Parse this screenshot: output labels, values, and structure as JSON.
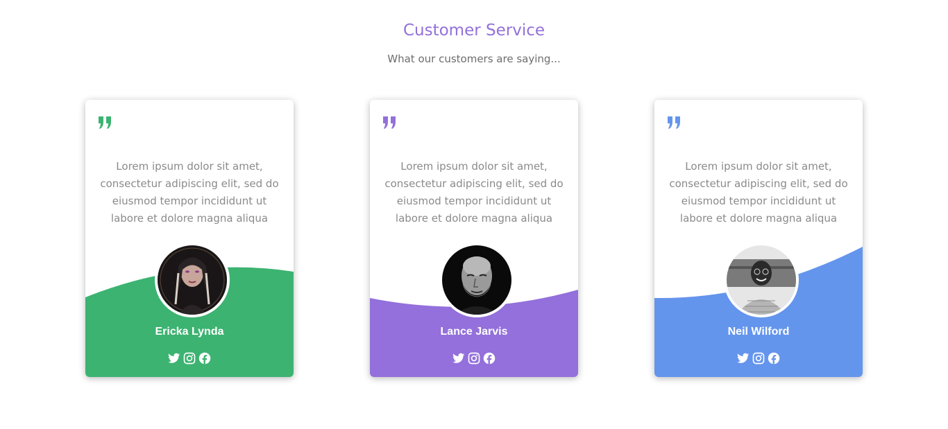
{
  "header": {
    "title": "Customer Service",
    "subtitle": "What our customers are saying..."
  },
  "cards": [
    {
      "quote_mark": "”",
      "text": "Lorem ipsum dolor sit amet, consectetur adipiscing elit, sed do eiusmod tempor incididunt ut labore et dolore magna aliqua",
      "name": "Ericka Lynda",
      "accent": "#3CB371",
      "avatar": "portrait-woman-dark-photo",
      "socials": [
        "twitter-icon",
        "instagram-icon",
        "facebook-icon"
      ]
    },
    {
      "quote_mark": "”",
      "text": "Lorem ipsum dolor sit amet, consectetur adipiscing elit, sed do eiusmod tempor incididunt ut labore et dolore magna aliqua",
      "name": "Lance Jarvis",
      "accent": "#9370DB",
      "avatar": "portrait-older-man-bw-photo",
      "socials": [
        "twitter-icon",
        "instagram-icon",
        "facebook-icon"
      ]
    },
    {
      "quote_mark": "”",
      "text": "Lorem ipsum dolor sit amet, consectetur adipiscing elit, sed do eiusmod tempor incididunt ut labore et dolore magna aliqua",
      "name": "Neil Wilford",
      "accent": "#6495ED",
      "avatar": "portrait-smiling-man-bw-photo",
      "socials": [
        "twitter-icon",
        "instagram-icon",
        "facebook-icon"
      ]
    }
  ]
}
